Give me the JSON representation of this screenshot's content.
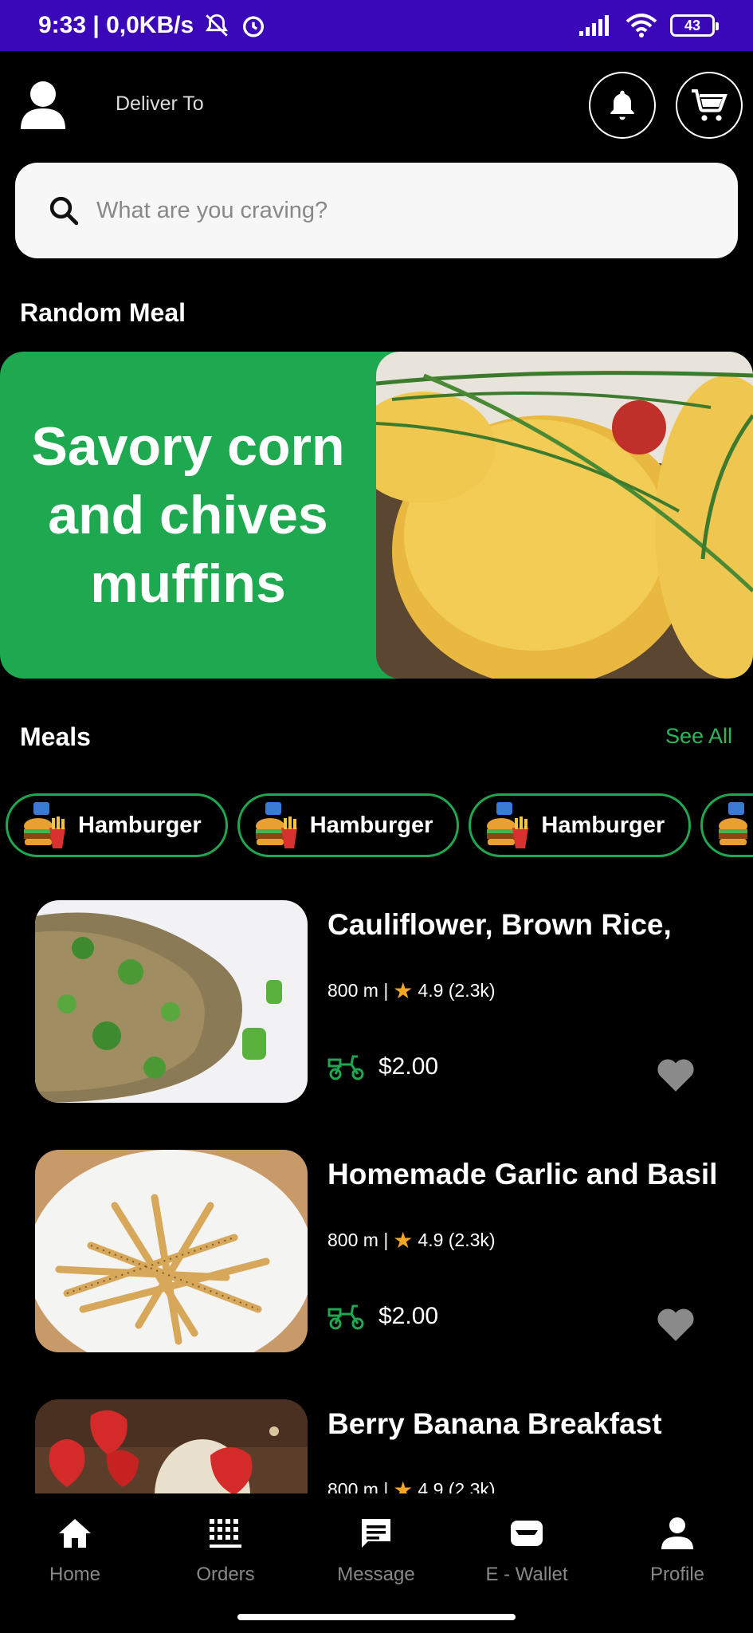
{
  "status_bar": {
    "time": "9:33 | 0,0KB/s",
    "battery": "43"
  },
  "header": {
    "deliver_to": "Deliver To"
  },
  "search": {
    "placeholder": "What are you craving?"
  },
  "random_meal": {
    "section_title": "Random Meal",
    "banner_title": "Savory corn and chives muffins"
  },
  "meals": {
    "section_title": "Meals",
    "see_all": "See All",
    "categories": [
      {
        "label": "Hamburger"
      },
      {
        "label": "Hamburger"
      },
      {
        "label": "Hamburger"
      },
      {
        "label": ""
      }
    ],
    "items": [
      {
        "title": "Cauliflower, Brown Rice,",
        "distance": "800 m |",
        "rating": "4.9 (2.3k)",
        "price": "$2.00"
      },
      {
        "title": "Homemade Garlic and Basil",
        "distance": "800 m |",
        "rating": "4.9 (2.3k)",
        "price": "$2.00"
      },
      {
        "title": "Berry Banana Breakfast",
        "distance": "800 m |",
        "rating": "4.9 (2.3k)",
        "price": ""
      }
    ]
  },
  "bottom_nav": [
    {
      "label": "Home",
      "icon": "home-icon"
    },
    {
      "label": "Orders",
      "icon": "orders-icon"
    },
    {
      "label": "Message",
      "icon": "message-icon"
    },
    {
      "label": "E - Wallet",
      "icon": "wallet-icon"
    },
    {
      "label": "Profile",
      "icon": "profile-icon"
    }
  ],
  "colors": {
    "status_bar": "#3a08b8",
    "accent_green": "#1ea850",
    "star": "#f5a623"
  }
}
